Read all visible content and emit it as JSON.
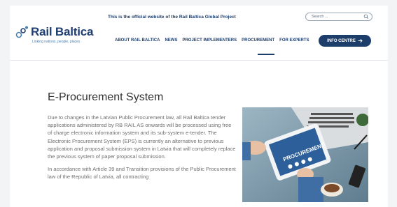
{
  "header": {
    "official_notice": "This is the official website of the Rail Baltica Global Project",
    "search_placeholder": "Search ..."
  },
  "logo": {
    "name": "Rail Baltica",
    "tagline": "Linking nations, people, places"
  },
  "nav": {
    "items": [
      {
        "label": "ABOUT RAIL BALTICA",
        "active": false
      },
      {
        "label": "NEWS",
        "active": false
      },
      {
        "label": "PROJECT IMPLEMENTERS",
        "active": false
      },
      {
        "label": "PROCUREMENT",
        "active": true
      },
      {
        "label": "FOR EXPERTS",
        "active": false
      }
    ],
    "info_button": "INFO CENTRE",
    "info_button_icon": "arrow-right-icon"
  },
  "main": {
    "title": "E-Procurement System",
    "paragraphs": [
      "Due to changes in the Latvian Public Procurement law, all Rail Baltica tender applications administered by RB RAIL AS onwards will be processed using free of charge electronic information system and its sub-system e-tender. The Electronic Procurement System (EPS) is currently an alternative to previous application and proposal submission system in Latvia that will completely replace the previous system of paper proposal submission.",
      "In accordance with Article 39 and Transition provisions of the Public Procurement law of the Republic of Latvia, all contracting"
    ],
    "image_label": "PROCUREMENT"
  },
  "colors": {
    "brand_navy": "#1d3d6b",
    "brand_light_blue": "#4a7fb0",
    "text_grey": "#6f6f6f"
  }
}
